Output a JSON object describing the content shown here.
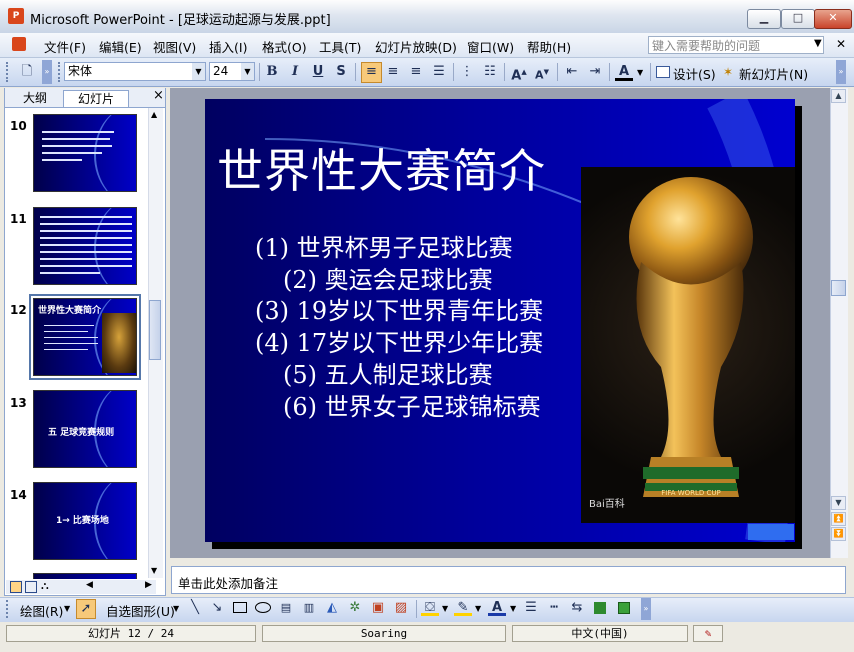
{
  "window": {
    "app_icon_text": "P",
    "title": "Microsoft PowerPoint - [足球运动起源与发展.ppt]",
    "minimize": "▁",
    "maximize": "□",
    "close": "✕"
  },
  "menubar": {
    "items": [
      "文件(F)",
      "编辑(E)",
      "视图(V)",
      "插入(I)",
      "格式(O)",
      "工具(T)",
      "幻灯片放映(D)",
      "窗口(W)",
      "帮助(H)"
    ],
    "help_placeholder": "键入需要帮助的问题"
  },
  "toolbar": {
    "font_name": "宋体",
    "font_size": "24",
    "bold": "B",
    "italic": "I",
    "underline": "U",
    "shadow": "S",
    "design_label": "设计(S)",
    "new_slide_label": "新幻灯片(N)"
  },
  "left_pane": {
    "tab_outline": "大纲",
    "tab_slides": "幻灯片",
    "close": "×",
    "slides": [
      {
        "num": "10"
      },
      {
        "num": "11"
      },
      {
        "num": "12",
        "title": "世界性大赛简介",
        "selected": true
      },
      {
        "num": "13",
        "title": "五  足球竞赛规则"
      },
      {
        "num": "14",
        "title": "1→  比赛场地"
      }
    ]
  },
  "slide": {
    "title": "世界性大赛简介",
    "bullets": [
      "(1) 世界杯男子足球比赛",
      "(2) 奥运会足球比赛",
      "(3) 19岁以下世界青年比赛",
      "(4) 17岁以下世界少年比赛",
      "(5) 五人制足球比赛",
      "(6) 世界女子足球锦标赛"
    ],
    "watermark": "Bai百科"
  },
  "notes": {
    "placeholder": "单击此处添加备注"
  },
  "drawbar": {
    "draw_label": "绘图(R)",
    "autoshapes_label": "自选图形(U)"
  },
  "statusbar": {
    "slide_pos": "幻灯片 12 / 24",
    "design": "Soaring",
    "language": "中文(中国)"
  },
  "colors": {
    "slide_background": "#0000c0",
    "accent": "#2f6df0"
  }
}
